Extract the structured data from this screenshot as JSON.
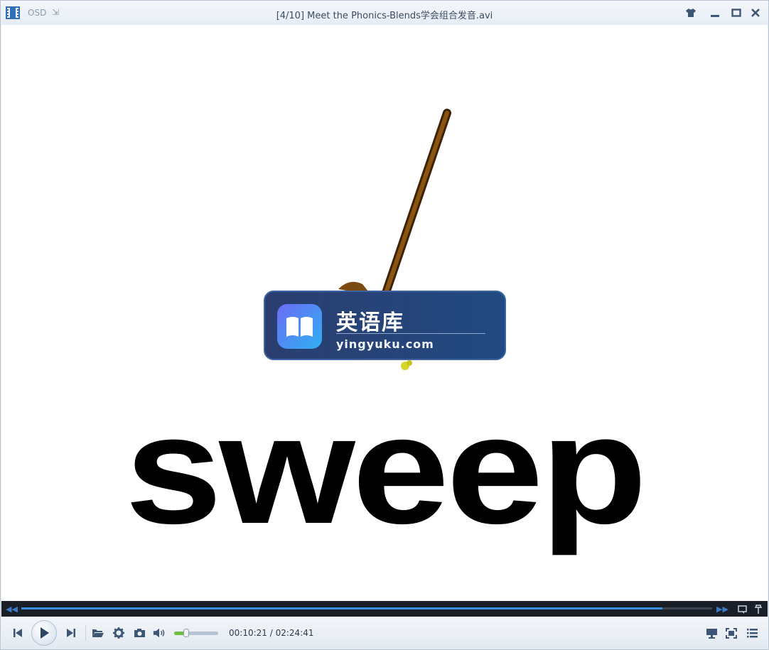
{
  "titlebar": {
    "osd_label": "OSD",
    "title": "[4/10] Meet the Phonics-Blends学会组合发音.avi"
  },
  "video": {
    "word": "sweep",
    "watermark": {
      "name_cn": "英语库",
      "domain": "yingyuku.com"
    }
  },
  "playback": {
    "current_time": "00:10:21",
    "separator": "/",
    "total_time": "02:24:41",
    "progress_fraction": 0.928,
    "volume_fraction": 0.28
  },
  "colors": {
    "accent": "#3b8de0",
    "volume": "#6fc040",
    "watermark_bg": "#214a82"
  }
}
